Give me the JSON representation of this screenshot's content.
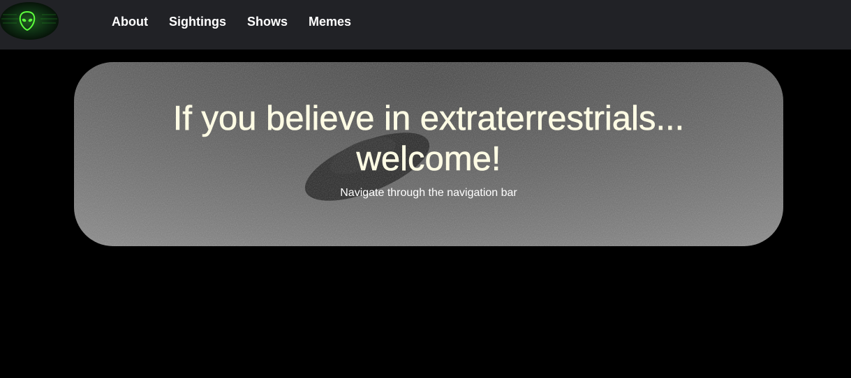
{
  "nav": {
    "logo_icon": "alien-head-icon",
    "links": [
      {
        "label": "About"
      },
      {
        "label": "Sightings"
      },
      {
        "label": "Shows"
      },
      {
        "label": "Memes"
      }
    ]
  },
  "hero": {
    "title_line1": "If you believe in extraterrestrials...",
    "title_line2": "welcome!",
    "subtitle": "Navigate through the navigation bar"
  },
  "colors": {
    "navbar_bg": "#212226",
    "page_bg": "#000000",
    "title_text": "#fdfbe4",
    "logo_glow": "#39ff14"
  }
}
